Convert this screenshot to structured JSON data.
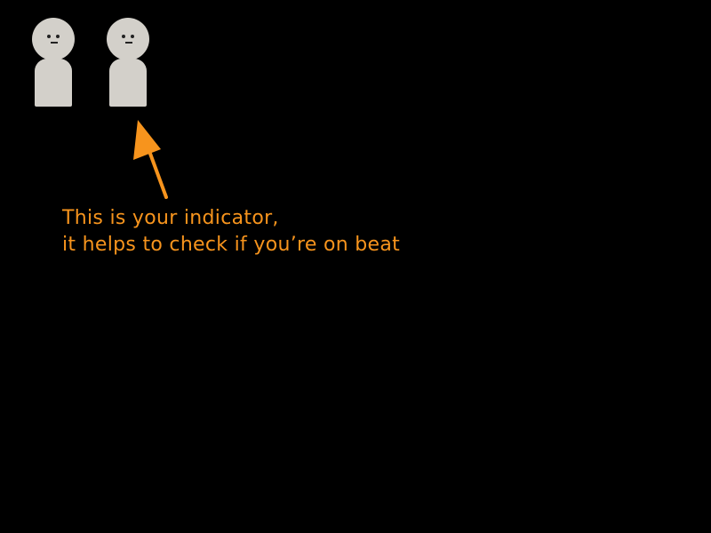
{
  "scene": {
    "background_color": "#000000",
    "figure_color": "#d3d0ca",
    "figures": [
      {
        "id": "player-figure",
        "role": "player"
      },
      {
        "id": "indicator-figure",
        "role": "indicator"
      }
    ]
  },
  "tutorial": {
    "accent_color": "#f7941d",
    "line1": "This is your indicator,",
    "line2": "it helps to check if you’re on beat"
  }
}
